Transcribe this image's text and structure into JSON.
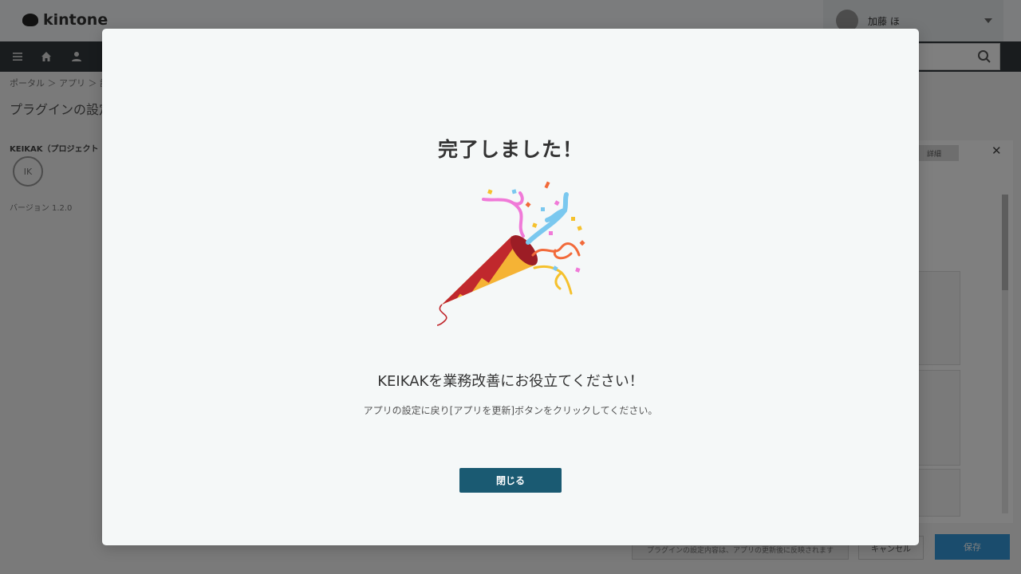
{
  "app": {
    "logo_text": "kintone",
    "user_name": "加藤 ほ",
    "breadcrumb": "ポータル ＞ アプリ ＞ 設定",
    "page_title": "プラグインの設定",
    "plugin_name": "KEIKAK（プロジェクト",
    "plugin_badge": "IK",
    "plugin_sub": "バージョン 1.2.0",
    "side_tab": "詳細",
    "footer_hint": "プラグインの設定内容は、アプリの更新後に反映されます",
    "footer_cancel": "キャンセル",
    "footer_save": "保存"
  },
  "modal": {
    "title": "完了しました！",
    "lead": "KEIKAKを業務改善にお役立てください！",
    "note": "アプリの設定に戻り[アプリを更新]ボタンをクリックしてください。",
    "close_label": "閉じる"
  },
  "colors": {
    "primary_button": "#1a5a72",
    "overlay": "rgba(0,0,0,0.5)",
    "modal_bg": "#f5f8f8"
  },
  "icons": {
    "party": "party-popper-icon",
    "nav": [
      "menu-icon",
      "home-icon",
      "people-icon"
    ],
    "search": "search-icon"
  }
}
